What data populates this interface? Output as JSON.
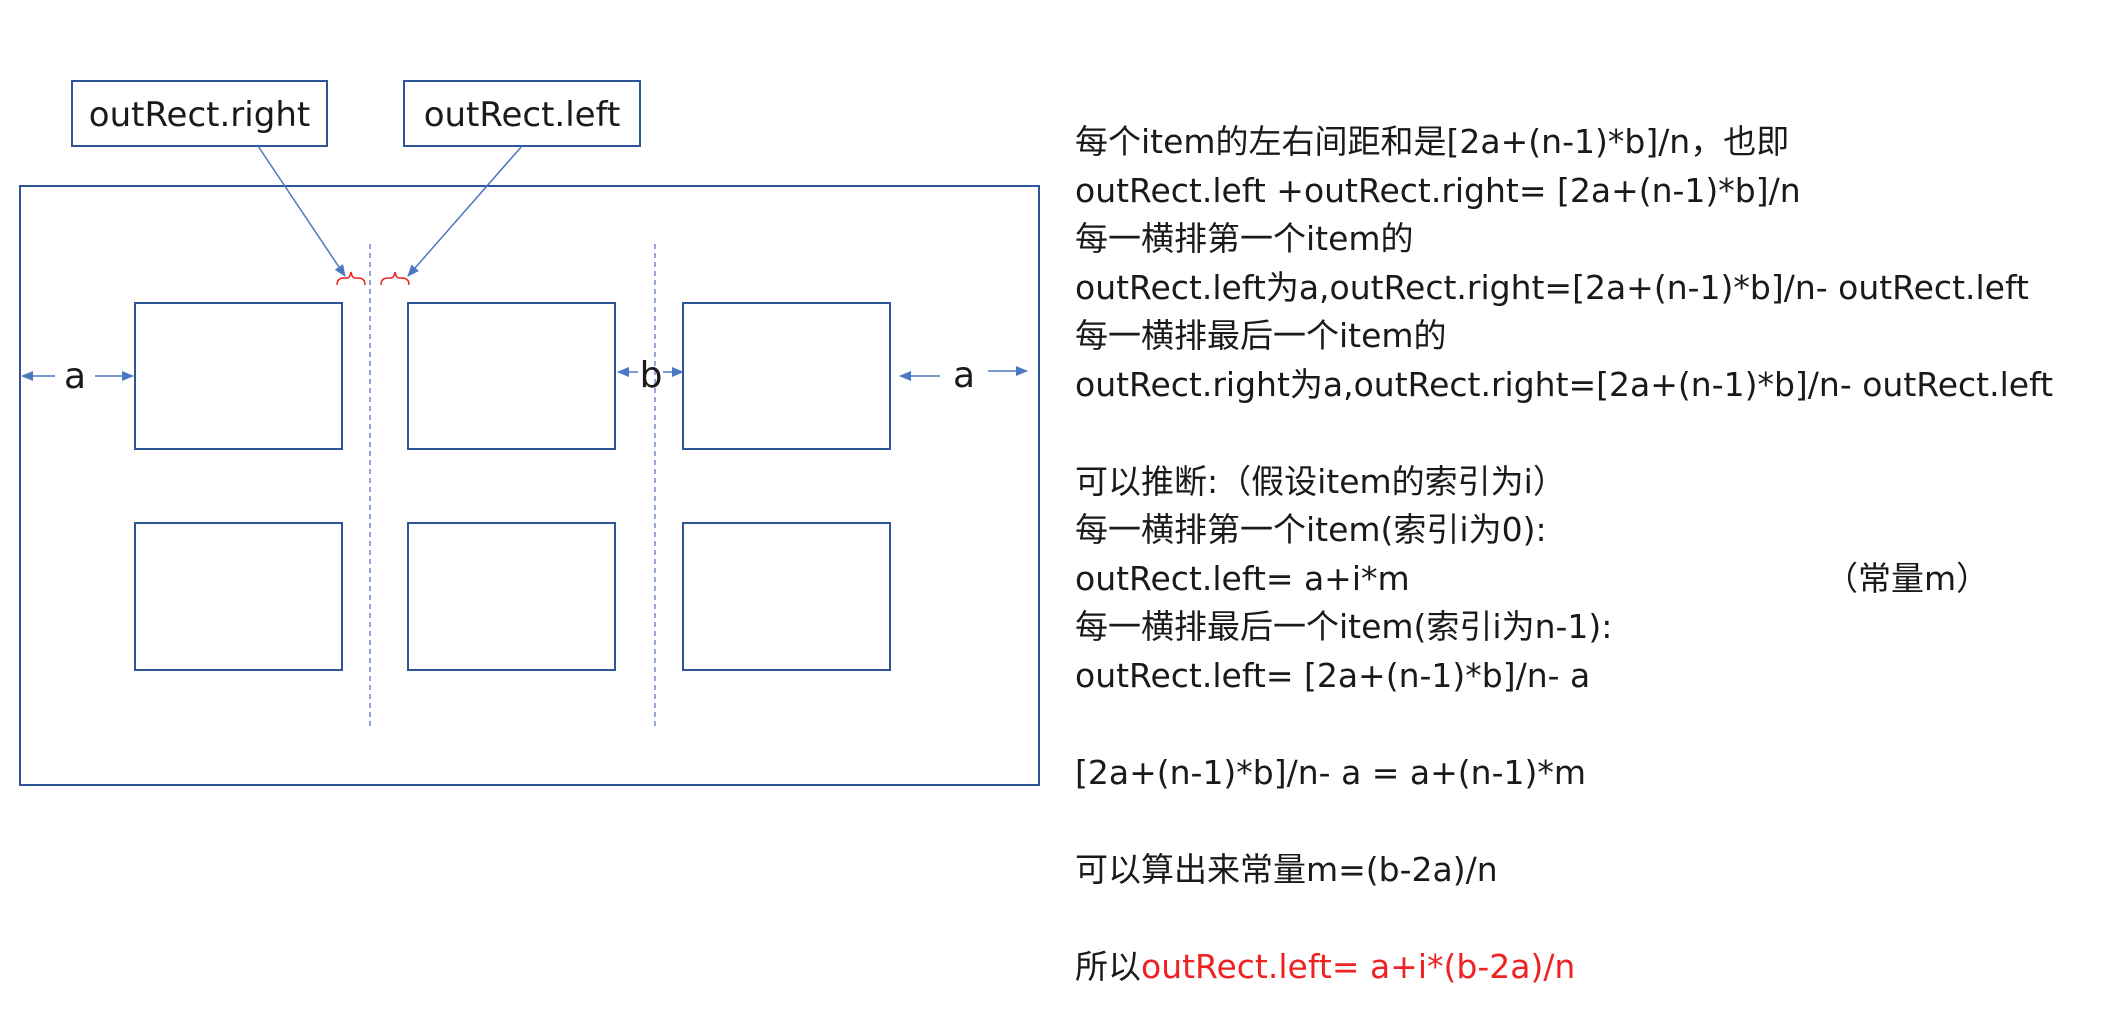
{
  "diagram": {
    "labels": {
      "out_rect_right": "outRect.right",
      "out_rect_left": "outRect.left",
      "a_left": "a",
      "b_gap": "b",
      "a_right": "a"
    },
    "grid": {
      "rows": 2,
      "columns": 3
    },
    "colors": {
      "frame": "#2e5597",
      "item_border": "#2e5597",
      "arrow": "#4a78c2",
      "dashed_guide": "#6f8fc8",
      "bracket": "#ee2222",
      "highlight_text": "#ee2222",
      "text": "#1a1a1a"
    }
  },
  "notes": {
    "line1": "每个item的左右间距和是[2a+(n-1)*b]/n，也即",
    "line2": "outRect.left +outRect.right= [2a+(n-1)*b]/n",
    "line3": "每一横排第一个item的",
    "line4": "outRect.left为a,outRect.right=[2a+(n-1)*b]/n- outRect.left",
    "line5": "每一横排最后一个item的",
    "line6": "outRect.right为a,outRect.right=[2a+(n-1)*b]/n- outRect.left",
    "line7": "可以推断:（假设item的索引为i）",
    "line8": "每一横排第一个item(索引i为0):",
    "line9": "outRect.left= a+i*m",
    "line9_note": "（常量m）",
    "line10": "每一横排最后一个item(索引i为n-1):",
    "line11": "outRect.left= [2a+(n-1)*b]/n- a",
    "line12": "[2a+(n-1)*b]/n- a = a+(n-1)*m",
    "line13": "可以算出来常量m=(b-2a)/n",
    "line14_prefix": "所以",
    "line14_highlight": "outRect.left= a+i*(b-2a)/n"
  }
}
